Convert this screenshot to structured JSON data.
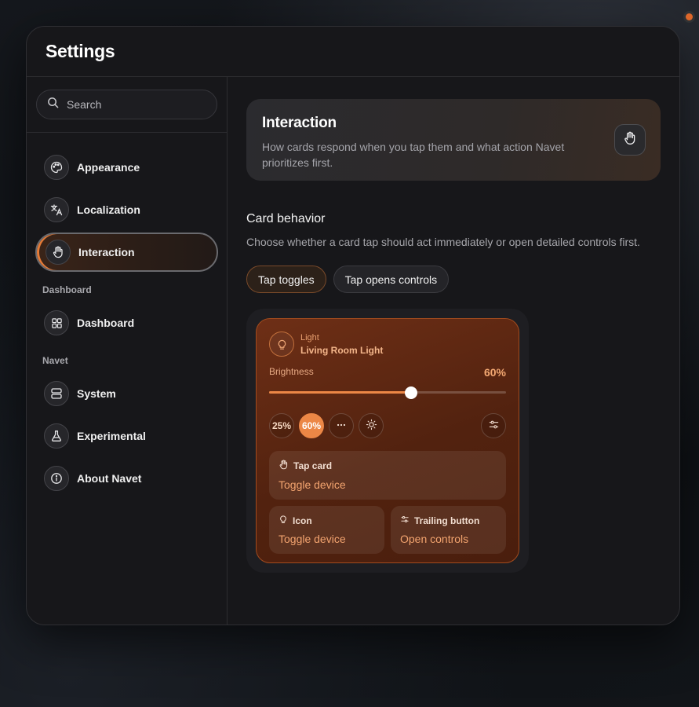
{
  "window": {
    "title": "Settings"
  },
  "search": {
    "placeholder": "Search"
  },
  "sidebar": {
    "items": [
      {
        "label": "Appearance",
        "icon": "palette-icon"
      },
      {
        "label": "Localization",
        "icon": "translate-icon"
      },
      {
        "label": "Interaction",
        "icon": "hand-icon",
        "active": true
      }
    ],
    "sections": [
      {
        "title": "Dashboard",
        "items": [
          {
            "label": "Dashboard",
            "icon": "grid-icon"
          }
        ]
      },
      {
        "title": "Navet",
        "items": [
          {
            "label": "System",
            "icon": "server-icon"
          },
          {
            "label": "Experimental",
            "icon": "flask-icon"
          },
          {
            "label": "About Navet",
            "icon": "info-icon"
          }
        ]
      }
    ]
  },
  "hero": {
    "title": "Interaction",
    "description": "How cards respond when you tap them and what action Navet prioritizes first."
  },
  "card_behavior": {
    "title": "Card behavior",
    "description": "Choose whether a card tap should act immediately or open detailed controls first.",
    "options": [
      "Tap toggles",
      "Tap opens controls"
    ],
    "selected": "Tap toggles"
  },
  "preview": {
    "kind": "Light",
    "name": "Living Room Light",
    "brightness_label": "Brightness",
    "brightness_value": "60%",
    "brightness_level": 0.6,
    "presets": [
      "25%",
      "60%"
    ],
    "active_preset": "60%",
    "tap_card": {
      "label": "Tap card",
      "action": "Toggle device"
    },
    "icon": {
      "label": "Icon",
      "action": "Toggle device"
    },
    "trailing": {
      "label": "Trailing button",
      "action": "Open controls"
    }
  },
  "colors": {
    "accent": "#ec8746",
    "window_bg": "#17171a",
    "card_bg": "#5e2812"
  }
}
